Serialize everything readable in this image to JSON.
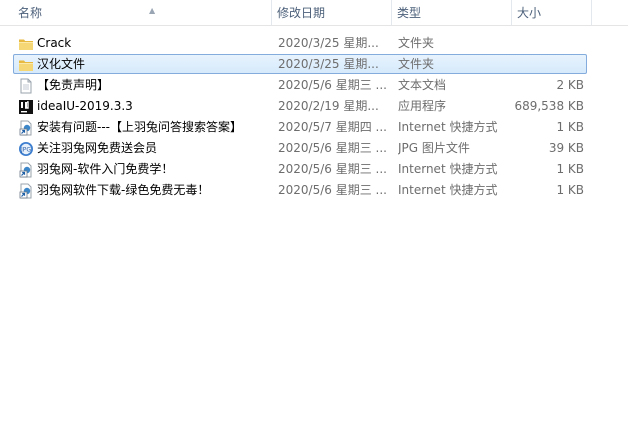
{
  "columns": {
    "name": "名称",
    "date": "修改日期",
    "type": "类型",
    "size": "大小"
  },
  "files": [
    {
      "name": "Crack",
      "date": "2020/3/25 星期...",
      "type": "文件夹",
      "size": "",
      "icon": "folder-icon",
      "selected": false
    },
    {
      "name": "汉化文件",
      "date": "2020/3/25 星期...",
      "type": "文件夹",
      "size": "",
      "icon": "folder-icon",
      "selected": true
    },
    {
      "name": "【免责声明】",
      "date": "2020/5/6 星期三 ...",
      "type": "文本文档",
      "size": "2 KB",
      "icon": "text-file-icon",
      "selected": false
    },
    {
      "name": "ideaIU-2019.3.3",
      "date": "2020/2/19 星期...",
      "type": "应用程序",
      "size": "689,538 KB",
      "icon": "intellij-app-icon",
      "selected": false
    },
    {
      "name": "安装有问题---【上羽兔问答搜索答案】",
      "date": "2020/5/7 星期四 ...",
      "type": "Internet 快捷方式",
      "size": "1 KB",
      "icon": "internet-shortcut-icon",
      "selected": false
    },
    {
      "name": "关注羽兔网免费送会员",
      "date": "2020/5/6 星期三 ...",
      "type": "JPG 图片文件",
      "size": "39 KB",
      "icon": "jpg-file-icon",
      "selected": false
    },
    {
      "name": "羽兔网-软件入门免费学！",
      "date": "2020/5/6 星期三 ...",
      "type": "Internet 快捷方式",
      "size": "1 KB",
      "icon": "internet-shortcut-icon",
      "selected": false
    },
    {
      "name": "羽兔网软件下载-绿色免费无毒！",
      "date": "2020/5/6 星期三 ...",
      "type": "Internet 快捷方式",
      "size": "1 KB",
      "icon": "internet-shortcut-icon",
      "selected": false
    }
  ]
}
